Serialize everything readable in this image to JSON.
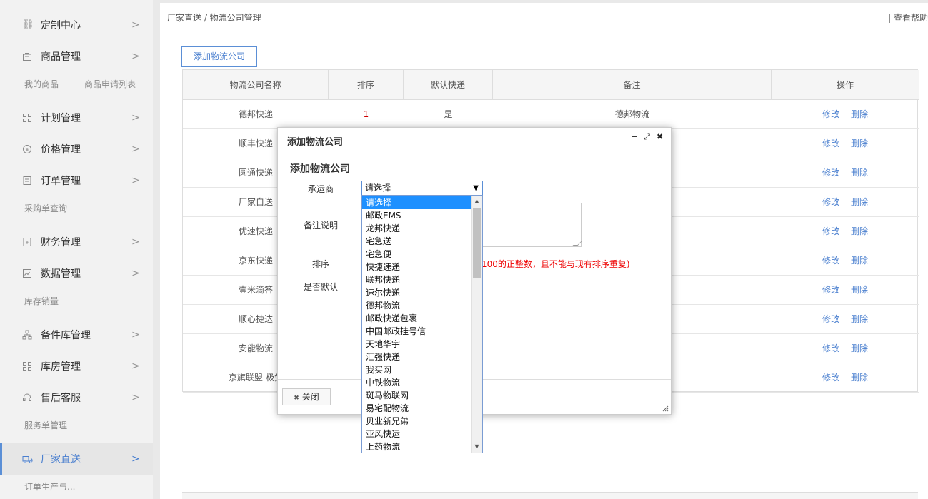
{
  "sidebar": {
    "items": [
      {
        "label": "定制中心",
        "icon": "link-icon"
      },
      {
        "label": "商品管理",
        "icon": "bag-icon"
      },
      {
        "label": "计划管理",
        "icon": "grid-icon"
      },
      {
        "label": "价格管理",
        "icon": "price-icon"
      },
      {
        "label": "订单管理",
        "icon": "list-icon"
      },
      {
        "label": "财务管理",
        "icon": "finance-icon"
      },
      {
        "label": "数据管理",
        "icon": "chart-icon"
      },
      {
        "label": "备件库管理",
        "icon": "hierarchy-icon"
      },
      {
        "label": "库房管理",
        "icon": "grid-icon"
      },
      {
        "label": "售后客服",
        "icon": "headset-icon"
      },
      {
        "label": "厂家直送",
        "icon": "truck-icon"
      }
    ],
    "sub": {
      "goods": [
        "我的商品",
        "商品申请列表"
      ],
      "orders": [
        "采购单查询"
      ],
      "data": [
        "库存销量"
      ],
      "service": [
        "服务单管理"
      ],
      "direct": [
        "订单生产与..."
      ]
    },
    "arrow": ">"
  },
  "header": {
    "breadcrumb": "厂家直送 / 物流公司管理",
    "help": "| 查看帮助"
  },
  "toolbar": {
    "add_label": "添加物流公司"
  },
  "table": {
    "columns": [
      "物流公司名称",
      "排序",
      "默认快递",
      "备注",
      "操作"
    ],
    "rows": [
      {
        "name": "德邦快递",
        "sort": "1",
        "default": "是",
        "note": "德邦物流"
      },
      {
        "name": "顺丰快递",
        "sort": "",
        "default": "",
        "note": ""
      },
      {
        "name": "圆通快递",
        "sort": "",
        "default": "",
        "note": ""
      },
      {
        "name": "厂家自送",
        "sort": "",
        "default": "",
        "note": ""
      },
      {
        "name": "优速快递",
        "sort": "",
        "default": "",
        "note": ""
      },
      {
        "name": "京东快递",
        "sort": "",
        "default": "",
        "note": ""
      },
      {
        "name": "壹米滴答",
        "sort": "",
        "default": "",
        "note": ""
      },
      {
        "name": "顺心捷达",
        "sort": "",
        "default": "",
        "note": ""
      },
      {
        "name": "安能物流",
        "sort": "",
        "default": "",
        "note": ""
      },
      {
        "name": "京旗联盟-极兔",
        "sort": "",
        "default": "",
        "note": ""
      }
    ],
    "edit_label": "修改",
    "delete_label": "删除"
  },
  "dialog": {
    "title": "添加物流公司",
    "heading": "添加物流公司",
    "labels": {
      "carrier": "承运商",
      "note": "备注说明",
      "sort": "排序",
      "is_default": "是否默认"
    },
    "sort_hint": "100的正整数，且不能与现有排序重复)",
    "close_label": "关闭",
    "close_icon_glyph": "✖",
    "ctrl": {
      "min": "−",
      "max": "⤢",
      "close": "✖"
    }
  },
  "select": {
    "value": "请选择",
    "caret": "▼",
    "options": [
      "请选择",
      "邮政EMS",
      "龙邦快递",
      "宅急送",
      "宅急便",
      "快捷速递",
      "联邦快递",
      "速尔快递",
      "德邦物流",
      "邮政快递包裹",
      "中国邮政挂号信",
      "天地华宇",
      "汇强快递",
      "我买网",
      "中铁物流",
      "斑马物联网",
      "易宅配物流",
      "贝业新兄弟",
      "亚风快运",
      "上药物流"
    ],
    "selected_index": 0,
    "scroll_up": "▲",
    "scroll_down": "▼"
  },
  "colors": {
    "accent": "#4a7fcf",
    "selected_option": "#1e90ff",
    "hint_red": "#e00000"
  }
}
